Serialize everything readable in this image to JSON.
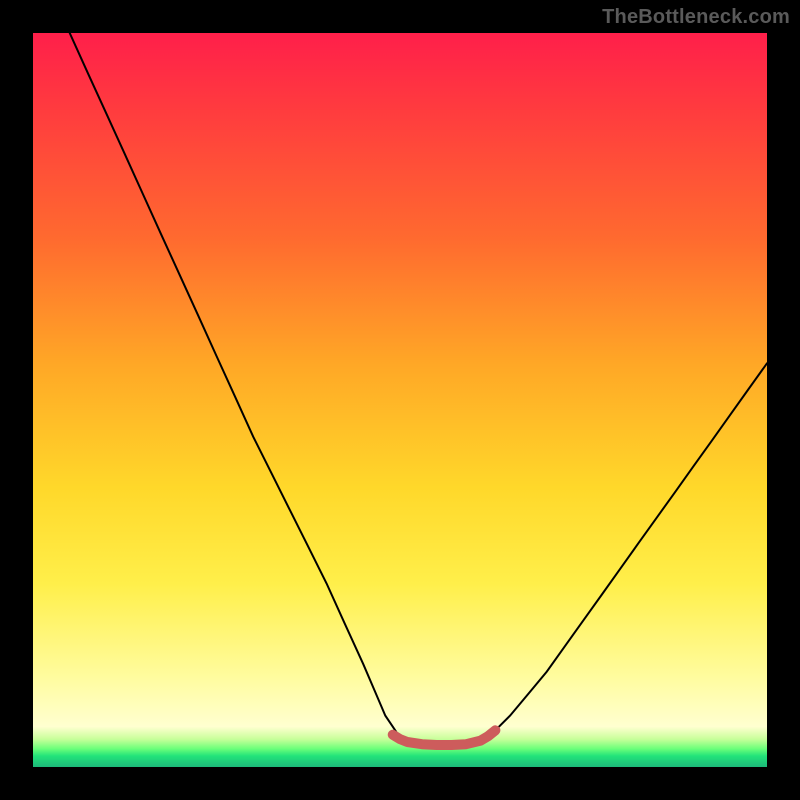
{
  "watermark": "TheBottleneck.com",
  "chart_data": {
    "type": "line",
    "title": "",
    "xlabel": "",
    "ylabel": "",
    "xlim": [
      0,
      100
    ],
    "ylim": [
      0,
      100
    ],
    "grid": false,
    "legend": false,
    "series": [
      {
        "name": "curve",
        "x": [
          5,
          10,
          15,
          20,
          25,
          30,
          35,
          40,
          45,
          48,
          50,
          52,
          55,
          58,
          60,
          62,
          65,
          70,
          75,
          80,
          85,
          90,
          95,
          100
        ],
        "y": [
          100,
          89,
          78,
          67,
          56,
          45,
          35,
          25,
          14,
          7,
          4,
          3,
          3,
          3,
          3,
          4,
          7,
          13,
          20,
          27,
          34,
          41,
          48,
          55
        ]
      },
      {
        "name": "bottom-marker",
        "x": [
          49,
          50,
          51,
          53,
          55,
          57,
          59,
          61,
          62,
          63
        ],
        "y": [
          4.4,
          3.8,
          3.4,
          3.1,
          3.0,
          3.0,
          3.1,
          3.6,
          4.2,
          5.0
        ]
      }
    ],
    "colors": {
      "curve": "#000000",
      "marker": "#cd5c5c",
      "gradient_top": "#ff1f4a",
      "gradient_bottom": "#1db97a"
    }
  }
}
